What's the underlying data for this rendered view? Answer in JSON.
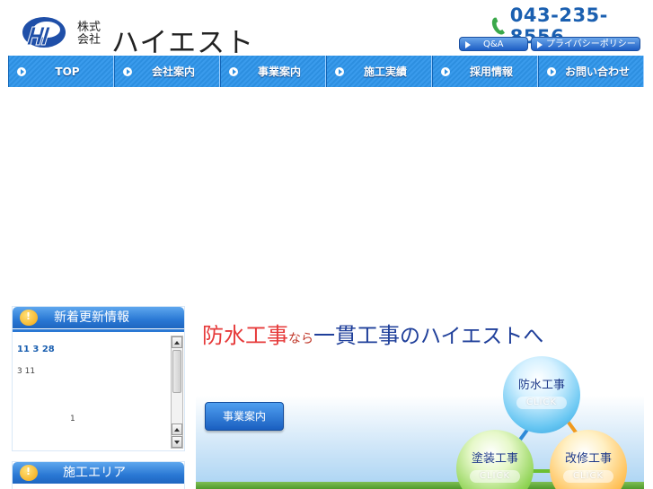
{
  "header": {
    "company_kind": "株式会社",
    "company_name": "ハイエスト",
    "phone": "043-235-8556",
    "buttons": {
      "qa": "Q&A",
      "privacy": "プライバシーポリシー"
    }
  },
  "nav": {
    "items": [
      {
        "label": "TOP"
      },
      {
        "label": "会社案内"
      },
      {
        "label": "事業案内"
      },
      {
        "label": "施工実績"
      },
      {
        "label": "採用情報"
      },
      {
        "label": "お問い合わせ"
      }
    ]
  },
  "news": {
    "title": "新着更新情報",
    "date": "11 3 28",
    "text": "3 11",
    "page": "1"
  },
  "area": {
    "title": "施工エリア"
  },
  "promo": {
    "headline_red": "防水工事",
    "headline_mid": "なら",
    "headline_blue": "一貫工事",
    "headline_tail": "のハイエストへ",
    "business_button": "事業案内",
    "circles": {
      "waterproof": {
        "title": "防水工事",
        "click": "CLICK"
      },
      "painting": {
        "title": "塗装工事",
        "click": "CLICK"
      },
      "renovation": {
        "title": "改修工事",
        "click": "CLICK"
      }
    }
  },
  "colors": {
    "accent": "#2d8fe0",
    "brand_blue": "#1a5fb0",
    "headline_red": "#e63a3a",
    "headline_navy": "#1f3f9a"
  }
}
